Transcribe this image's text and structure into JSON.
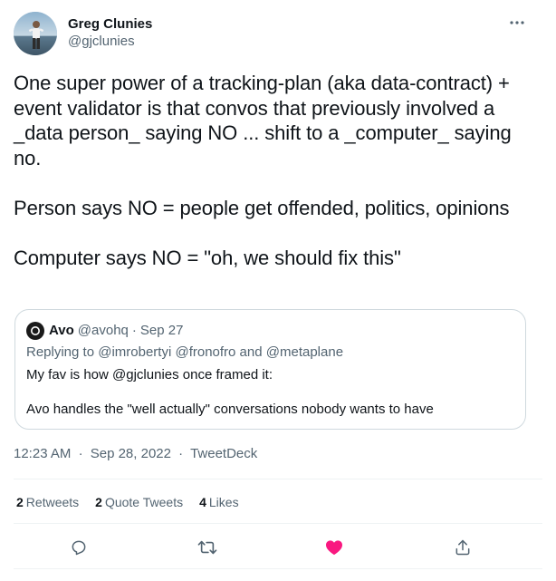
{
  "author": {
    "display_name": "Greg Clunies",
    "handle": "@gjclunies"
  },
  "tweet": {
    "paragraphs": [
      "One super power of a tracking-plan (aka data-contract) + event validator is that convos that previously involved a _data person_ saying NO ... shift to a _computer_ saying no.",
      "Person says NO = people get offended, politics, opinions",
      "Computer says NO = \"oh, we should fix this\""
    ]
  },
  "quote": {
    "name": "Avo",
    "handle": "@avohq",
    "separator": "·",
    "date": "Sep 27",
    "replying_prefix": "Replying to ",
    "mention_1": "@imrobertyi",
    "mention_2": "@fronofro",
    "and_text": " and ",
    "mention_3": "@metaplane",
    "line_1": "My fav is how @gjclunies once framed it:",
    "line_2": "Avo handles the \"well actually\" conversations nobody wants to have"
  },
  "meta": {
    "time": "12:23 AM",
    "separator": "·",
    "date": "Sep 28, 2022",
    "source": "TweetDeck"
  },
  "stats": {
    "retweets_count": "2",
    "retweets_label": "Retweets",
    "quotes_count": "2",
    "quotes_label": "Quote Tweets",
    "likes_count": "4",
    "likes_label": "Likes"
  },
  "colors": {
    "like_active": "#f91880",
    "icon_gray": "#536471",
    "border": "#cfd9de",
    "divider": "#eff3f4"
  },
  "icons": {
    "more": "more-dots-icon",
    "reply": "reply-bubble-icon",
    "retweet": "retweet-arrows-icon",
    "like": "heart-icon",
    "share": "share-upload-icon"
  }
}
